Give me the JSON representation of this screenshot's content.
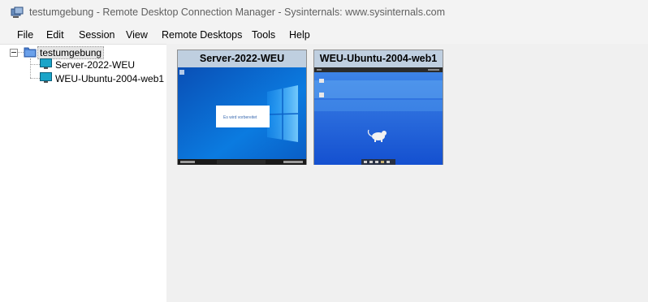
{
  "window": {
    "title": "testumgebung - Remote Desktop Connection Manager - Sysinternals: www.sysinternals.com"
  },
  "menu": {
    "items": [
      "File",
      "Edit",
      "Session",
      "View",
      "Remote Desktops",
      "Tools",
      "Help"
    ]
  },
  "tree": {
    "root": {
      "label": "testumgebung",
      "icon": "group-icon",
      "expanded": true
    },
    "children": [
      {
        "label": "Server-2022-WEU",
        "icon": "monitor-icon"
      },
      {
        "label": "WEU-Ubuntu-2004-web1",
        "icon": "monitor-icon"
      }
    ]
  },
  "thumbnails": [
    {
      "title": "Server-2022-WEU",
      "os": "windows",
      "dialog_text": "Es wird vorbereitet"
    },
    {
      "title": "WEU-Ubuntu-2004-web1",
      "os": "ubuntu-xfce"
    }
  ],
  "colors": {
    "thumb_header": "#bfcfe0",
    "windows_desktop": "#0a73d9",
    "xfce_desktop": "#1f62dd"
  }
}
